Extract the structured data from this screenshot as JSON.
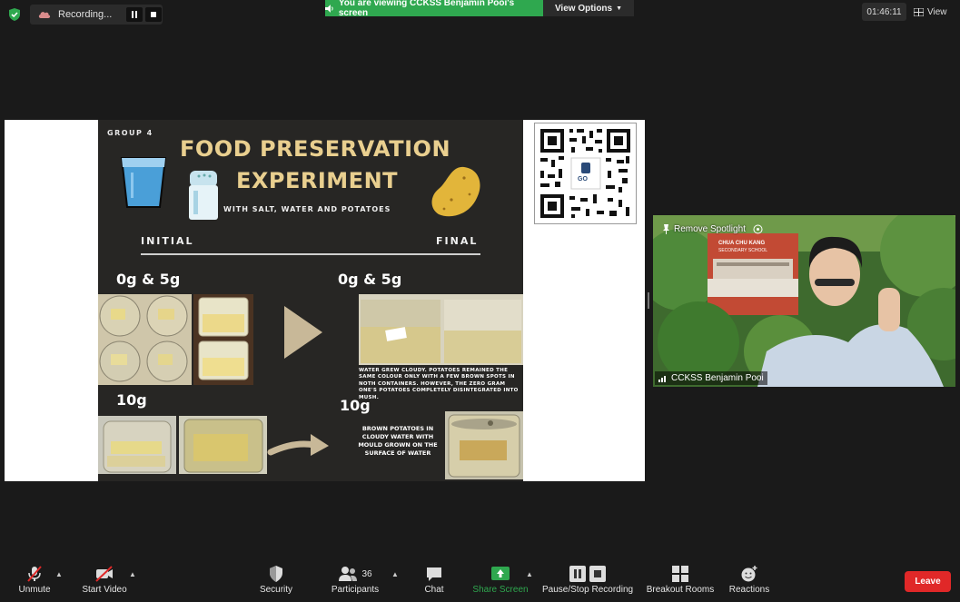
{
  "topbar": {
    "recording_label": "Recording...",
    "viewing_text": "You are viewing CCKSS Benjamin Pooi's screen",
    "view_options_label": "View Options",
    "timer": "01:46:11",
    "view_label": "View"
  },
  "slide": {
    "group": "GROUP 4",
    "title_line1": "FOOD PRESERVATION",
    "title_line2": "EXPERIMENT",
    "subtitle": "WITH SALT, WATER AND POTATOES",
    "initial_label": "INITIAL",
    "final_label": "FINAL",
    "initial_group1": "0g & 5g",
    "final_group1": "0g & 5g",
    "initial_group2": "10g",
    "final_group2": "10g",
    "caption1": "WATER GREW CLOUDY. POTATOES REMAINED THE SAME COLOUR ONLY WITH A FEW BROWN SPOTS IN NOTH CONTAINERS. HOWEVER, THE ZERO GRAM ONE'S POTATOES COMPLETELY DISINTEGRATED INTO MUSH.",
    "caption2": "BROWN POTATOES IN CLOUDY WATER WITH MOULD GROWN ON THE SURFACE OF WATER",
    "qr_logo": "GO"
  },
  "video": {
    "remove_spotlight": "Remove Spotlight",
    "participant_name": "CCKSS Benjamin Pooi",
    "school_sign_line1": "CHUA CHU KANG",
    "school_sign_line2": "SECONDARY SCHOOL"
  },
  "toolbar": {
    "unmute": "Unmute",
    "start_video": "Start Video",
    "security": "Security",
    "participants": "Participants",
    "participants_count": "36",
    "chat": "Chat",
    "share_screen": "Share Screen",
    "pause_stop_recording": "Pause/Stop Recording",
    "breakout_rooms": "Breakout Rooms",
    "reactions": "Reactions",
    "leave": "Leave"
  },
  "colors": {
    "viewing_banner": "#2fa84f",
    "share_screen_green": "#2fa84f",
    "leave_red": "#e02828",
    "slide_title": "#e9cf8f",
    "slide_bg": "#272624"
  }
}
